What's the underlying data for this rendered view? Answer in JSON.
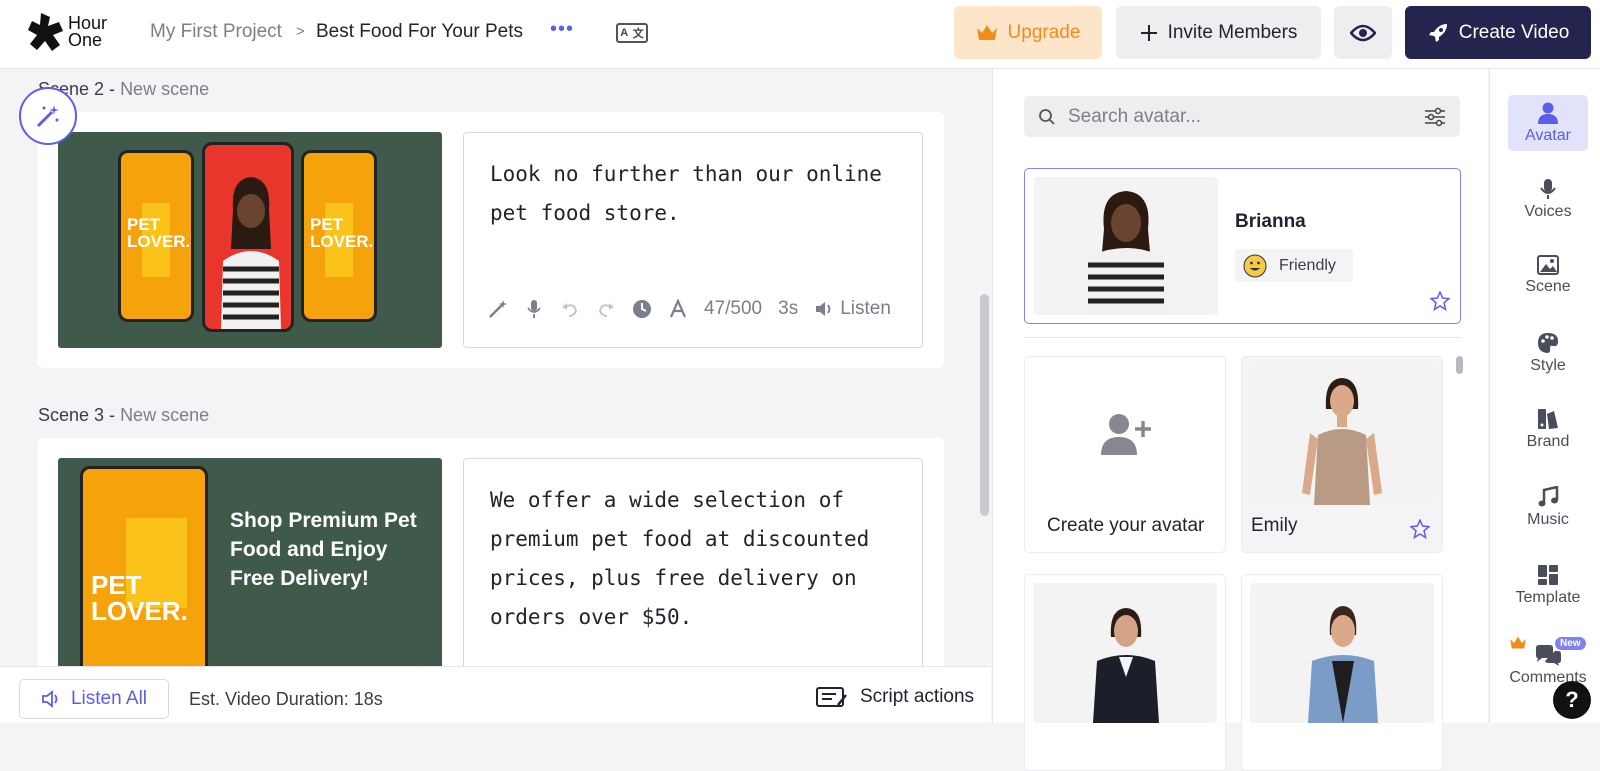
{
  "header": {
    "logo": "Hour One",
    "breadcrumb": [
      "My First Project",
      "Best Food For Your Pets"
    ],
    "upgrade_label": "Upgrade",
    "invite_label": "Invite Members",
    "create_label": "Create Video",
    "brand_color": "#25244f",
    "accent_color": "#5b5fe8"
  },
  "scenes": [
    {
      "label": "Scene 2 -",
      "sub": "New scene",
      "thumb_text": "PET LOVER.",
      "script": "Look no further than our online pet food store.",
      "char_count": "47/500",
      "duration": "3s",
      "listen_label": "Listen"
    },
    {
      "label": "Scene 3 -",
      "sub": "New scene",
      "thumb_text": "PET LOVER.",
      "headline": "Shop Premium Pet Food and Enjoy Free Delivery!",
      "script": "We offer a wide selection of premium pet food at discounted prices, plus free delivery on orders over $50."
    }
  ],
  "footer": {
    "listen_all": "Listen All",
    "duration": "Est. Video Duration: 18s",
    "script_actions": "Script actions"
  },
  "avatar_panel": {
    "search_placeholder": "Search avatar...",
    "selected": {
      "name": "Brianna",
      "mood": "Friendly"
    },
    "tiles": [
      {
        "label": "Create your avatar"
      },
      {
        "label": "Emily"
      }
    ]
  },
  "rail": {
    "items": [
      "Avatar",
      "Voices",
      "Scene",
      "Style",
      "Brand",
      "Music",
      "Template",
      "Comments"
    ],
    "new_badge": "New",
    "help": "?"
  }
}
